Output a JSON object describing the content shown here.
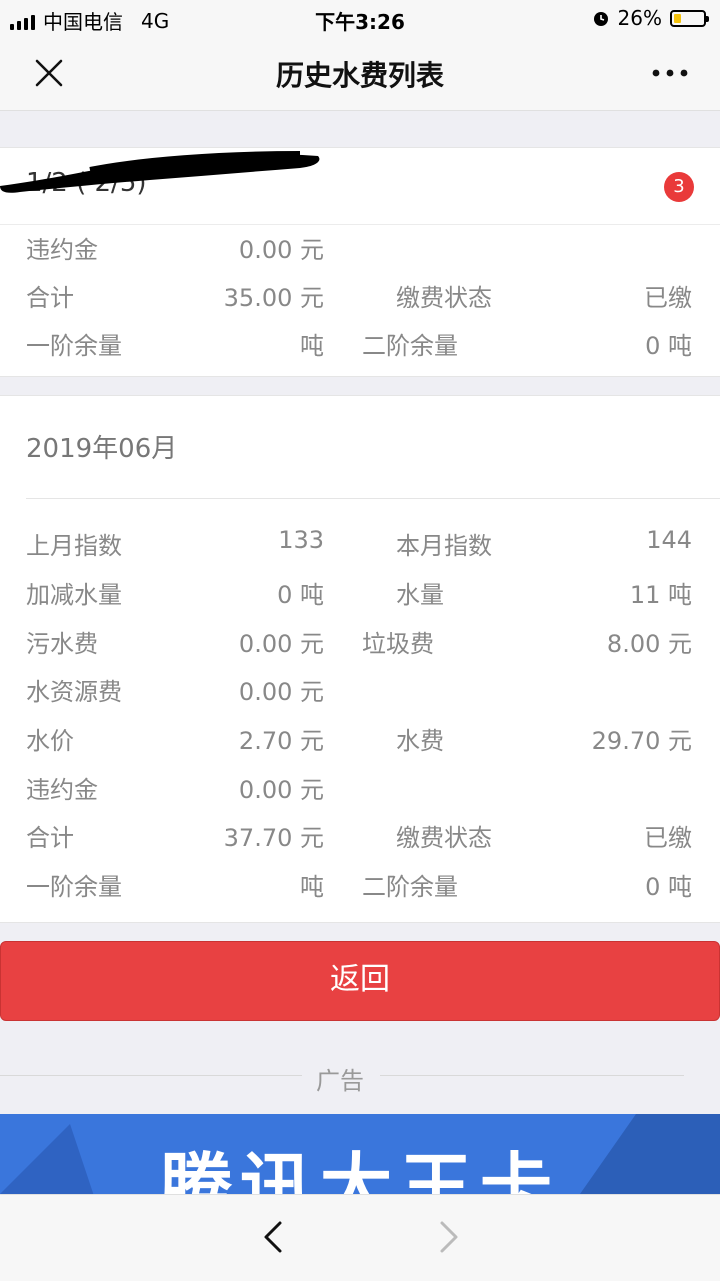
{
  "status_bar": {
    "carrier": "中国电信",
    "network": "4G",
    "time": "下午3:26",
    "battery": "26%",
    "battery_level": 0.26
  },
  "nav": {
    "title": "历史水费列表",
    "close_icon": "close-icon",
    "more_icon": "more-icon"
  },
  "account": {
    "id_partial": "1/2  ( 2/5)",
    "badge": "3"
  },
  "bill_prev": {
    "rows": [
      {
        "label_l": "违约金",
        "value_l": "0.00 元",
        "label_r": "",
        "value_r": ""
      },
      {
        "label_l": "合计",
        "value_l": "35.00 元",
        "label_r": "缴费状态",
        "value_r": "已缴"
      },
      {
        "label_l": "一阶余量",
        "value_l": "吨",
        "label_r": "二阶余量",
        "value_r": "0 吨"
      }
    ]
  },
  "bill_current": {
    "month": "2019年06月",
    "rows": [
      {
        "label_l": "上月指数",
        "value_l": "133",
        "label_r": "本月指数",
        "value_r": "144"
      },
      {
        "label_l": "加减水量",
        "value_l": "0 吨",
        "label_r": "水量",
        "value_r": "11 吨"
      },
      {
        "label_l": "污水费",
        "value_l": "0.00 元",
        "label_r": "垃圾费",
        "value_r": "8.00 元"
      },
      {
        "label_l": "水资源费",
        "value_l": "0.00 元",
        "label_r": "",
        "value_r": ""
      },
      {
        "label_l": "水价",
        "value_l": "2.70 元",
        "label_r": "水费",
        "value_r": "29.70 元"
      },
      {
        "label_l": "违约金",
        "value_l": "0.00 元",
        "label_r": "",
        "value_r": ""
      },
      {
        "label_l": "合计",
        "value_l": "37.70 元",
        "label_r": "缴费状态",
        "value_r": "已缴"
      },
      {
        "label_l": "一阶余量",
        "value_l": "吨",
        "label_r": "二阶余量",
        "value_r": "0 吨"
      }
    ]
  },
  "back_button": "返回",
  "ad": {
    "label": "广告",
    "banner_text": "腾讯大王卡"
  },
  "colors": {
    "accent_red": "#e84142",
    "badge_red": "#e93a3a",
    "ad_blue": "#3a76dc"
  }
}
